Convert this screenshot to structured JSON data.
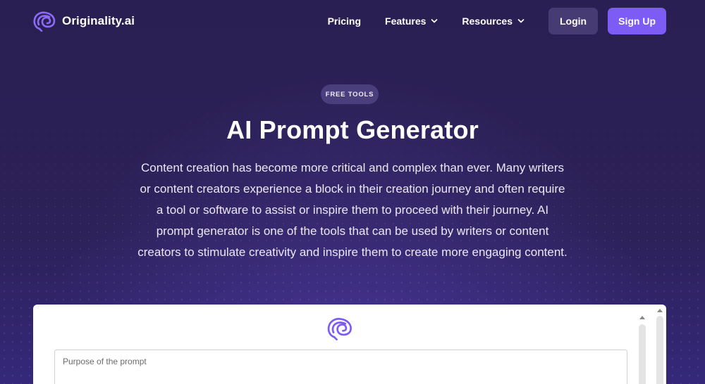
{
  "header": {
    "brand": "Originality.ai",
    "nav": [
      {
        "label": "Pricing",
        "has_dropdown": false
      },
      {
        "label": "Features",
        "has_dropdown": true
      },
      {
        "label": "Resources",
        "has_dropdown": true
      }
    ],
    "login_label": "Login",
    "signup_label": "Sign Up"
  },
  "hero": {
    "badge": "FREE TOOLS",
    "title": "AI Prompt Generator",
    "description_lines": [
      "Content creation has become more critical and complex than ever. Many writers",
      "or content creators experience a block in their creation journey and often require",
      "a tool or software to assist or inspire them to proceed with their journey. AI",
      "prompt generator is one of the tools that can be used by writers or content",
      "creators to stimulate creativity and inspire them to create more engaging content."
    ]
  },
  "tool": {
    "logo_icon": "brain-logo-icon",
    "purpose_placeholder": "Purpose of the prompt"
  },
  "colors": {
    "background": "#2a1f52",
    "accent": "#7c5cf5",
    "login_bg": "#463b73",
    "badge_bg": "#4a3f7c"
  }
}
